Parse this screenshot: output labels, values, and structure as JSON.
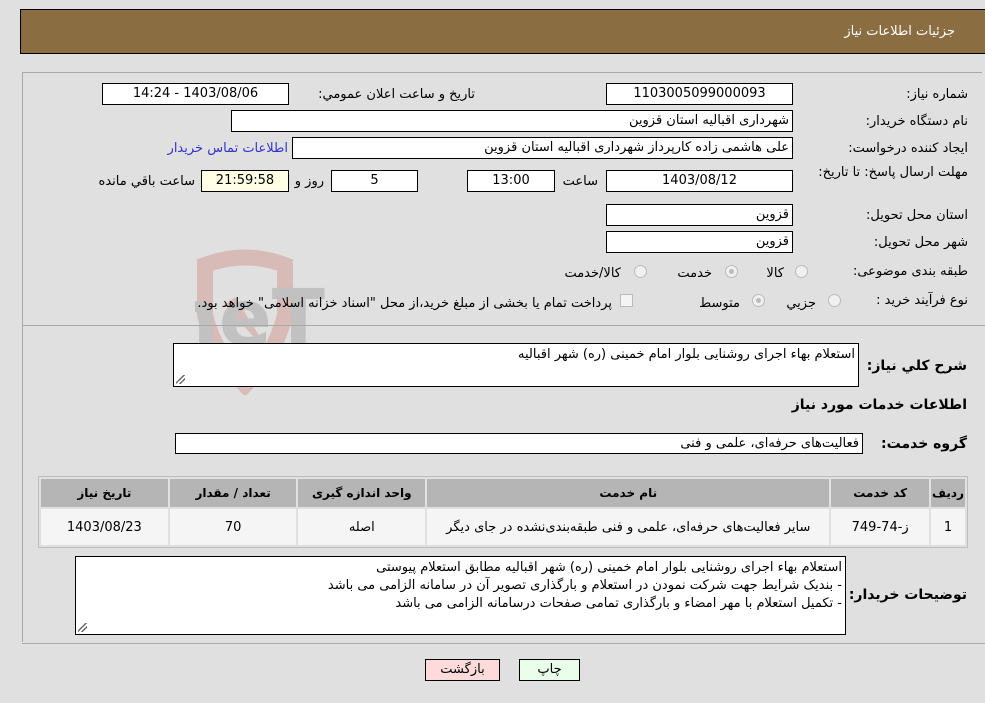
{
  "header": {
    "title": "جزئیات اطلاعات نیاز"
  },
  "fields": {
    "need_number": {
      "label": "شماره نیاز:",
      "value": "1103005099000093"
    },
    "announce_datetime": {
      "label": "تاریخ و ساعت اعلان عمومي:",
      "value": "1403/08/06 - 14:24"
    },
    "buyer_org": {
      "label": "نام دستگاه خریدار:",
      "value": "شهرداری اقبالیه استان قزوین"
    },
    "requester": {
      "label": "ایجاد کننده درخواست:",
      "value": "علی هاشمی زاده کارپرداز شهرداری اقبالیه استان قزوین"
    },
    "buyer_contact_link": "اطلاعات تماس خریدار",
    "deadline": {
      "label": "مهلت ارسال پاسخ: تا تاریخ:",
      "date": "1403/08/12",
      "time_label": "ساعت",
      "time": "13:00",
      "days": "5",
      "days_label": "روز و",
      "remaining": "21:59:58",
      "remaining_label": "ساعت باقي مانده"
    },
    "delivery_province": {
      "label": "استان محل تحویل:",
      "value": "قزوین"
    },
    "delivery_city": {
      "label": "شهر محل تحویل:",
      "value": "قزوین"
    },
    "category": {
      "label": "طبقه بندی موضوعی:",
      "options": [
        "کالا",
        "خدمت",
        "کالا/خدمت"
      ],
      "selected": "خدمت"
    },
    "process_type": {
      "label": "نوع فرآیند خرید :",
      "options": [
        "جزيي",
        "متوسط"
      ],
      "selected": "متوسط",
      "treasury_note": "پرداخت تمام یا بخشی از مبلغ خرید،از محل \"اسناد خزانه اسلامی\" خواهد بود."
    }
  },
  "general_description": {
    "label": "شرح کلي نياز:",
    "value": "استعلام بهاء اجرای روشنایی بلوار امام خمینی (ره) شهر اقبالیه"
  },
  "services_section": {
    "title": "اطلاعات خدمات مورد نیاز"
  },
  "service_group": {
    "label": "گروه خدمت:",
    "value": "فعالیت‌های حرفه‌ای، علمی و فنی"
  },
  "table": {
    "headers": [
      "ردیف",
      "کد خدمت",
      "نام خدمت",
      "واحد اندازه گیری",
      "تعداد / مقدار",
      "تاریخ نیاز"
    ],
    "rows": [
      [
        "1",
        "ز-74-749",
        "سایر فعالیت‌های حرفه‌ای، علمی و فنی طبقه‌بندی‌نشده در جای دیگر",
        "اصله",
        "70",
        "1403/08/23"
      ]
    ]
  },
  "buyer_notes": {
    "label": "توضیحات خریدار:",
    "lines": [
      "استعلام بهاء اجرای روشنایی بلوار امام خمینی (ره) شهر اقبالیه مطابق استعلام پیوستی",
      "- بندیک شرایط جهت شرکت نمودن در استعلام و بارگذاری تصویر آن در سامانه الزامی می باشد",
      "- تکمیل استعلام با مهر امضاء و بارگذاری تمامی صفحات درسامانه الزامی می باشد"
    ]
  },
  "buttons": {
    "print": "چاپ",
    "back": "بازگشت"
  },
  "colors": {
    "header_bg": "#8b6d42",
    "print_bg": "#eaffea",
    "back_bg": "#ffdada",
    "link": "#3333cc"
  },
  "watermark": "AriaTender.neT"
}
